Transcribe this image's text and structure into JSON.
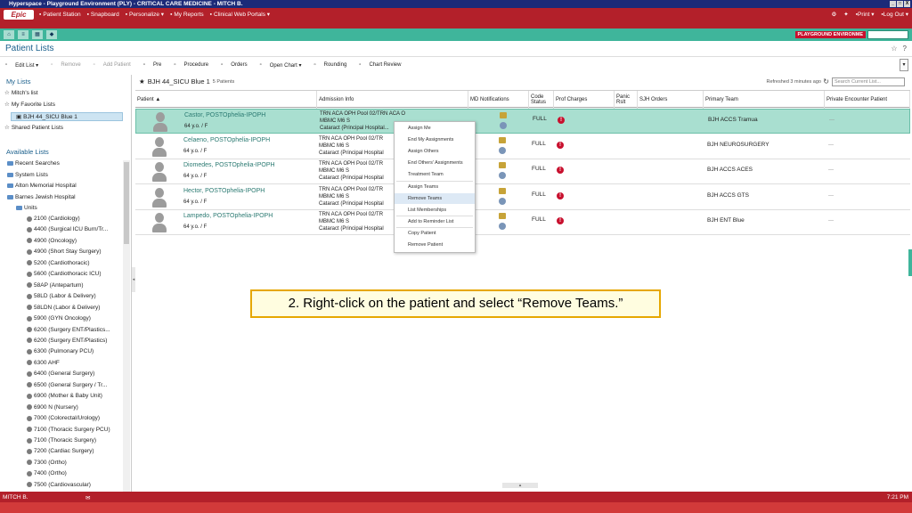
{
  "window": {
    "title": "Hyperspace - Playground Environment (PLY) - CRITICAL CARE MEDICINE - MITCH B.",
    "controls": [
      "_",
      "□",
      "X"
    ]
  },
  "menubar": {
    "logo": "Epic",
    "items": [
      {
        "icon": "patient-station-icon",
        "label": "Patient Station"
      },
      {
        "icon": "snapboard-icon",
        "label": "Snapboard"
      },
      {
        "icon": "personalize-icon",
        "label": "Personalize ▾"
      },
      {
        "icon": "reports-icon",
        "label": "My Reports"
      },
      {
        "icon": "globe-icon",
        "label": "Clinical Web Portals ▾"
      }
    ],
    "right_items": [
      {
        "icon": "print-icon",
        "label": "Print ▾"
      },
      {
        "icon": "logout-icon",
        "label": "Log Out ▾"
      }
    ]
  },
  "greenbar": {
    "environment": "PLAYGROUND ENVIRONME"
  },
  "activity": {
    "title": "Patient Lists"
  },
  "toolbar": {
    "items": [
      {
        "label": "Edit List ▾",
        "disabled": false
      },
      {
        "label": "Remove",
        "disabled": true
      },
      {
        "label": "Add Patient",
        "disabled": true
      },
      {
        "label": "Pre",
        "disabled": false
      },
      {
        "label": "Procedure",
        "disabled": false
      },
      {
        "label": "Orders",
        "disabled": false
      },
      {
        "label": "Open Chart ▾",
        "disabled": false
      },
      {
        "label": "Rounding",
        "disabled": false
      },
      {
        "label": "Chart Review",
        "disabled": false
      }
    ]
  },
  "sidebar": {
    "my_lists_heading": "My Lists",
    "my_lists": [
      {
        "label": "Mitch's list",
        "indent": 1,
        "selected": false
      },
      {
        "label": "My Favorite Lists",
        "indent": 1,
        "selected": false
      },
      {
        "label": "BJH 44_SICU Blue 1",
        "indent": 2,
        "selected": true
      },
      {
        "label": "Shared Patient Lists",
        "indent": 1,
        "selected": false
      }
    ],
    "available_heading": "Available Lists",
    "available": [
      {
        "label": "Recent Searches",
        "indent": 1
      },
      {
        "label": "System Lists",
        "indent": 1
      },
      {
        "label": "Alton Memorial Hospital",
        "indent": 1
      },
      {
        "label": "Barnes Jewish Hospital",
        "indent": 1
      },
      {
        "label": "Units",
        "indent": 2
      }
    ],
    "units": [
      "2100 (Cardiology)",
      "4400 (Surgical ICU Burn/Tr...",
      "4900 (Oncology)",
      "4900 (Short Stay Surgery)",
      "5200 (Cardiothoracic)",
      "5600 (Cardiothoracic ICU)",
      "58AP (Antepartum)",
      "58LD (Labor & Delivery)",
      "58LDN (Labor & Delivery)",
      "5900 (GYN Oncology)",
      "6200 (Surgery ENT/Plastics...",
      "6200 (Surgery ENT/Plastics)",
      "6300 (Pulmonary PCU)",
      "6300 AHF",
      "6400 (General Surgery)",
      "6500 (General Surgery / Tr...",
      "6900 (Mother & Baby Unit)",
      "6900 N (Nursery)",
      "7000 (Colorectal/Urology)",
      "7100 (Thoracic Surgery PCU)",
      "7100 (Thoracic Surgery)",
      "7200 (Cardiac Surgery)",
      "7300 (Ortho)",
      "7400 (Ortho)",
      "7500 (Cardiovascular)"
    ]
  },
  "list": {
    "title": "BJH 44_SICU Blue 1",
    "count": "5 Patients",
    "refreshed": "Refreshed 3 minutes ago",
    "search_placeholder": "Search Current List...",
    "columns": [
      {
        "label": "Patient ▲"
      },
      {
        "label": "Admission Info"
      },
      {
        "label": "MD Notifications"
      },
      {
        "label": "Code Status"
      },
      {
        "label": "Prof Charges"
      },
      {
        "label": "Panic Rslt"
      },
      {
        "label": "SJH Orders"
      },
      {
        "label": "Primary Team"
      },
      {
        "label": "Private Encounter Patient"
      }
    ],
    "rows": [
      {
        "name": "Castor, POSTOphelia-IPOPH",
        "info": "64 y.o. / F",
        "admit1": "TRN ACA OPH Pool 02/TRN ACA OPH Pool 02",
        "admit2": "MBMC M6 S",
        "admit3": "Cataract (Principal Hospital...",
        "code": "FULL",
        "team": "BJH ACCS Tramua",
        "private": "—",
        "selected": true
      },
      {
        "name": "Celaeno, POSTOphelia-IPOPH",
        "info": "64 y.o. / F",
        "admit1": "TRN ACA OPH Pool 02/TR",
        "admit2": "MBMC M6 S",
        "admit3": "Cataract (Principal Hospital",
        "code": "FULL",
        "team": "BJH NEUROSURGERY",
        "private": "—",
        "selected": false
      },
      {
        "name": "Diomedes, POSTOphelia-IPOPH",
        "info": "64 y.o. / F",
        "admit1": "TRN ACA OPH Pool 02/TR",
        "admit2": "MBMC M6 S",
        "admit3": "Cataract (Principal Hospital",
        "code": "FULL",
        "team": "BJH ACCS ACES",
        "private": "—",
        "selected": false
      },
      {
        "name": "Hector, POSTOphelia-IPOPH",
        "info": "64 y.o. / F",
        "admit1": "TRN ACA OPH Pool 02/TR",
        "admit2": "MBMC M6 S",
        "admit3": "Cataract (Principal Hospital",
        "code": "FULL",
        "team": "BJH ACCS GTS",
        "private": "—",
        "selected": false
      },
      {
        "name": "Lampedo, POSTOphelia-IPOPH",
        "info": "64 y.o. / F",
        "admit1": "TRN ACA OPH Pool 02/TR",
        "admit2": "MBMC M6 S",
        "admit3": "Cataract (Principal Hospital",
        "code": "FULL",
        "team": "BJH ENT Blue",
        "private": "—",
        "selected": false
      }
    ]
  },
  "context_menu": {
    "items": [
      {
        "label": "Assign Me",
        "highlighted": false
      },
      {
        "label": "End My Assignments",
        "highlighted": false
      },
      {
        "label": "Assign Others",
        "highlighted": false
      },
      {
        "label": "End Others' Assignments",
        "highlighted": false
      },
      {
        "label": "Treatment Team",
        "highlighted": false
      },
      {
        "label": "Assign Teams",
        "highlighted": false
      },
      {
        "label": "Remove Teams",
        "highlighted": true
      },
      {
        "label": "List Memberships",
        "highlighted": false
      },
      {
        "label": "Add to Reminder List",
        "highlighted": false
      },
      {
        "label": "Copy Patient",
        "highlighted": false
      },
      {
        "label": "Remove Patient",
        "highlighted": false
      }
    ]
  },
  "callout": {
    "text": "2. Right-click on the patient and select “Remove Teams.”"
  },
  "statusbar": {
    "user": "MITCH B.",
    "time": "7:21 PM"
  }
}
